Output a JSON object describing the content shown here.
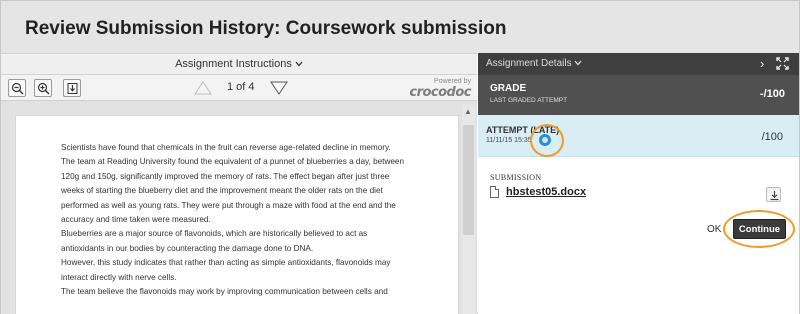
{
  "header": {
    "title": "Review Submission History: Coursework submission"
  },
  "instructions": {
    "label": "Assignment Instructions",
    "chevron": "chevron-down-icon"
  },
  "toolbar": {
    "zoom_out_icon": "zoom-out-icon",
    "zoom_in_icon": "zoom-in-icon",
    "download_icon": "download-icon",
    "page_info": "1 of 4",
    "powered_by": "Powered by",
    "brand": "crocodoc"
  },
  "document": {
    "lines": [
      "Scientists have found that chemicals in the fruit can reverse age-related decline in memory.",
      "The team at Reading University found the equivalent of a punnet of blueberries a day, between",
      "120g and 150g, significantly improved the memory of rats. The effect began after just three",
      "weeks of starting the blueberry diet and the improvement meant the older rats on the diet",
      "performed as well as young rats. They were put through a maze with food at the end and the",
      "accuracy and time taken were measured.",
      "Blueberries are a major source of flavonoids, which are historically believed to act as",
      "antioxidants in our bodies by counteracting the damage done to DNA.",
      "However, this study indicates that rather than acting as simple antioxidants,  flavonoids may",
      "interact directly with nerve cells.",
      "The team believe the flavonoids may work by improving communication between cells and"
    ]
  },
  "details": {
    "label": "Assignment Details",
    "grade_title": "GRADE",
    "grade_sub": "LAST GRADED ATTEMPT",
    "grade_value": "-/100",
    "attempt_title": "ATTEMPT (LATE)",
    "attempt_date": "11/11/15 15:35",
    "attempt_score": "/100",
    "submission_label": "SUBMISSION",
    "file_name": "hbstest05.docx",
    "ok_label": "OK",
    "continue_label": "Continue"
  },
  "colors": {
    "highlight_ring": "#f09a2a",
    "attempt_bg": "#d9edf4",
    "grade_bg": "#505050"
  }
}
